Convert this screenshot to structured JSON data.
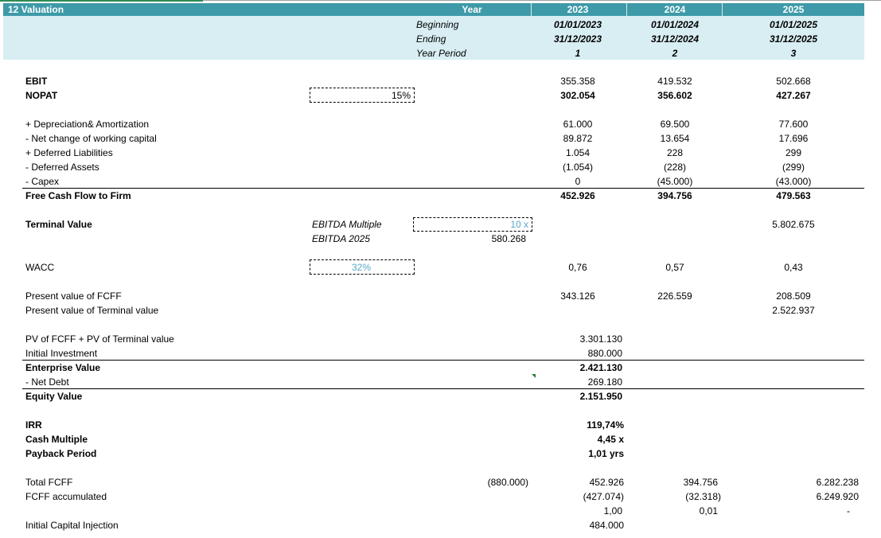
{
  "header": {
    "title": "12  Valuation",
    "year_label": "Year",
    "years": [
      "2023",
      "2024",
      "2025"
    ],
    "row_labels": [
      "Beginning",
      "Ending",
      "Year Period"
    ],
    "beginning": [
      "01/01/2023",
      "01/01/2024",
      "01/01/2025"
    ],
    "ending": [
      "31/12/2023",
      "31/12/2024",
      "31/12/2025"
    ],
    "period": [
      "1",
      "2",
      "3"
    ]
  },
  "ebit": {
    "label": "EBIT",
    "values": [
      "355.358",
      "419.532",
      "502.668"
    ]
  },
  "nopat": {
    "label": "NOPAT",
    "tax_input": "15%",
    "values": [
      "302.054",
      "356.602",
      "427.267"
    ]
  },
  "adjustments": [
    {
      "label": "+ Depreciation& Amortization",
      "values": [
        "61.000",
        "69.500",
        "77.600"
      ]
    },
    {
      "label": "- Net change of working capital",
      "values": [
        "89.872",
        "13.654",
        "17.696"
      ]
    },
    {
      "label": "+ Deferred Liabilities",
      "values": [
        "1.054",
        "228",
        "299"
      ]
    },
    {
      "label": "- Deferred Assets",
      "values": [
        "(1.054)",
        "(228)",
        "(299)"
      ]
    },
    {
      "label": "- Capex",
      "values": [
        "0",
        "(45.000)",
        "(43.000)"
      ]
    }
  ],
  "fcff": {
    "label": "Free Cash Flow to Firm",
    "values": [
      "452.926",
      "394.756",
      "479.563"
    ]
  },
  "terminal": {
    "label": "Terminal Value",
    "multiple_label": "EBITDA Multiple",
    "multiple_input": "10 x",
    "ebitda_label": "EBITDA 2025",
    "ebitda_value": "580.268",
    "value_2025": "5.802.675"
  },
  "wacc": {
    "label": "WACC",
    "input": "32%",
    "values": [
      "0,76",
      "0,57",
      "0,43"
    ]
  },
  "pv_fcff": {
    "label": "Present value of FCFF",
    "values": [
      "343.126",
      "226.559",
      "208.509"
    ]
  },
  "pv_tv": {
    "label": "Present value of Terminal value",
    "value_2025": "2.522.937"
  },
  "summary": [
    {
      "label": "PV of FCFF + PV of Terminal value",
      "value": "3.301.130",
      "bold": false
    },
    {
      "label": "Initial Investment",
      "value": "880.000",
      "bold": false
    },
    {
      "label": "Enterprise Value",
      "value": "2.421.130",
      "bold": true
    },
    {
      "label": "- Net Debt",
      "value": "269.180",
      "bold": false
    },
    {
      "label": "Equity Value",
      "value": "2.151.950",
      "bold": true
    }
  ],
  "returns": [
    {
      "label": "IRR",
      "value": "119,74%"
    },
    {
      "label": "Cash Multiple",
      "value": "4,45 x"
    },
    {
      "label": "Payback Period",
      "value": "1,01 yrs"
    }
  ],
  "total_fcff": {
    "label": "Total FCFF",
    "initial": "(880.000)",
    "values": [
      "452.926",
      "394.756",
      "6.282.238"
    ]
  },
  "fcff_accum": {
    "label": "FCFF accumulated",
    "values": [
      "(427.074)",
      "(32.318)",
      "6.249.920"
    ]
  },
  "ratio_row": {
    "values": [
      "1,00",
      "0,01",
      "-"
    ]
  },
  "capital_injection": {
    "label": "Initial Capital Injection",
    "value": "484.000"
  },
  "colors": {
    "header_bg": "#3e9aa8",
    "subheader_bg": "#d8eef3",
    "input_text": "#5aa7c9",
    "top_accent": "#2e8b57"
  }
}
